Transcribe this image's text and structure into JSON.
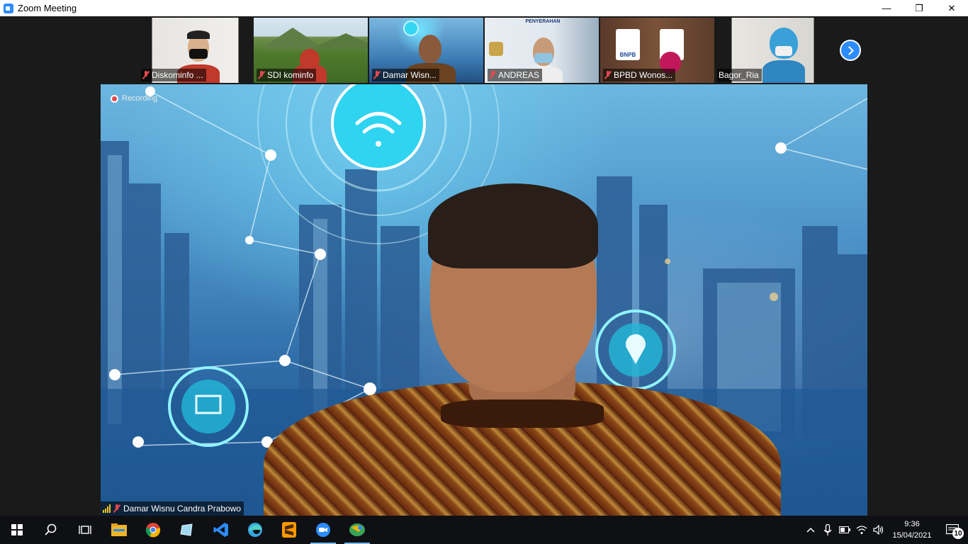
{
  "window": {
    "title": "Zoom Meeting",
    "minimize": "—",
    "restore": "❐",
    "close": "✕"
  },
  "recording": {
    "label": "Recording"
  },
  "participants": [
    {
      "name": "Diskominfo ...",
      "muted": true
    },
    {
      "name": "SDI kominfo",
      "muted": true
    },
    {
      "name": "Damar Wisn...",
      "muted": true,
      "active": true
    },
    {
      "name": "ANDREAS",
      "muted": true
    },
    {
      "name": "BPBD Wonos...",
      "muted": true
    },
    {
      "name": "Bagor_Ria",
      "muted": false
    }
  ],
  "thumb_texts": {
    "penyerahan": "PENYERAHAN",
    "bnpb": "BNPB"
  },
  "main_speaker": {
    "name": "Damar Wisnu Candra Prabowo",
    "muted": true
  },
  "taskbar": {
    "apps": [
      "start-icon",
      "search-icon",
      "task-view-icon",
      "file-explorer-icon",
      "chrome-icon",
      "notes-icon",
      "vscode-icon",
      "edge-icon",
      "sublime-icon",
      "zoom-icon",
      "maps-icon"
    ],
    "time": "9:36",
    "date": "15/04/2021",
    "notification_count": "10"
  },
  "colors": {
    "accent": "#2d8cff",
    "active_border": "#b9d84a",
    "muted": "#e5484d",
    "taskbar": "#0f1014"
  }
}
